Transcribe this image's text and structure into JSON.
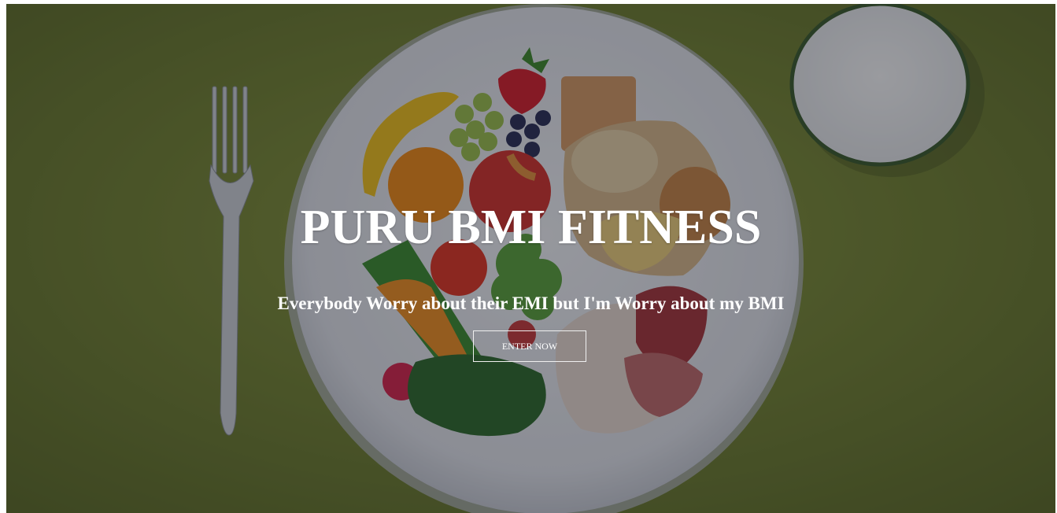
{
  "hero": {
    "title": "PURU BMI FITNESS",
    "subtitle": "Everybody Worry about their EMI but I'm Worry about my BMI",
    "cta_label": "ENTER NOW",
    "background": {
      "subject": "plate of healthy food with fork and glass of milk on green table",
      "table_color": "#6b7a2e",
      "overlay_color": "#14161e"
    }
  }
}
